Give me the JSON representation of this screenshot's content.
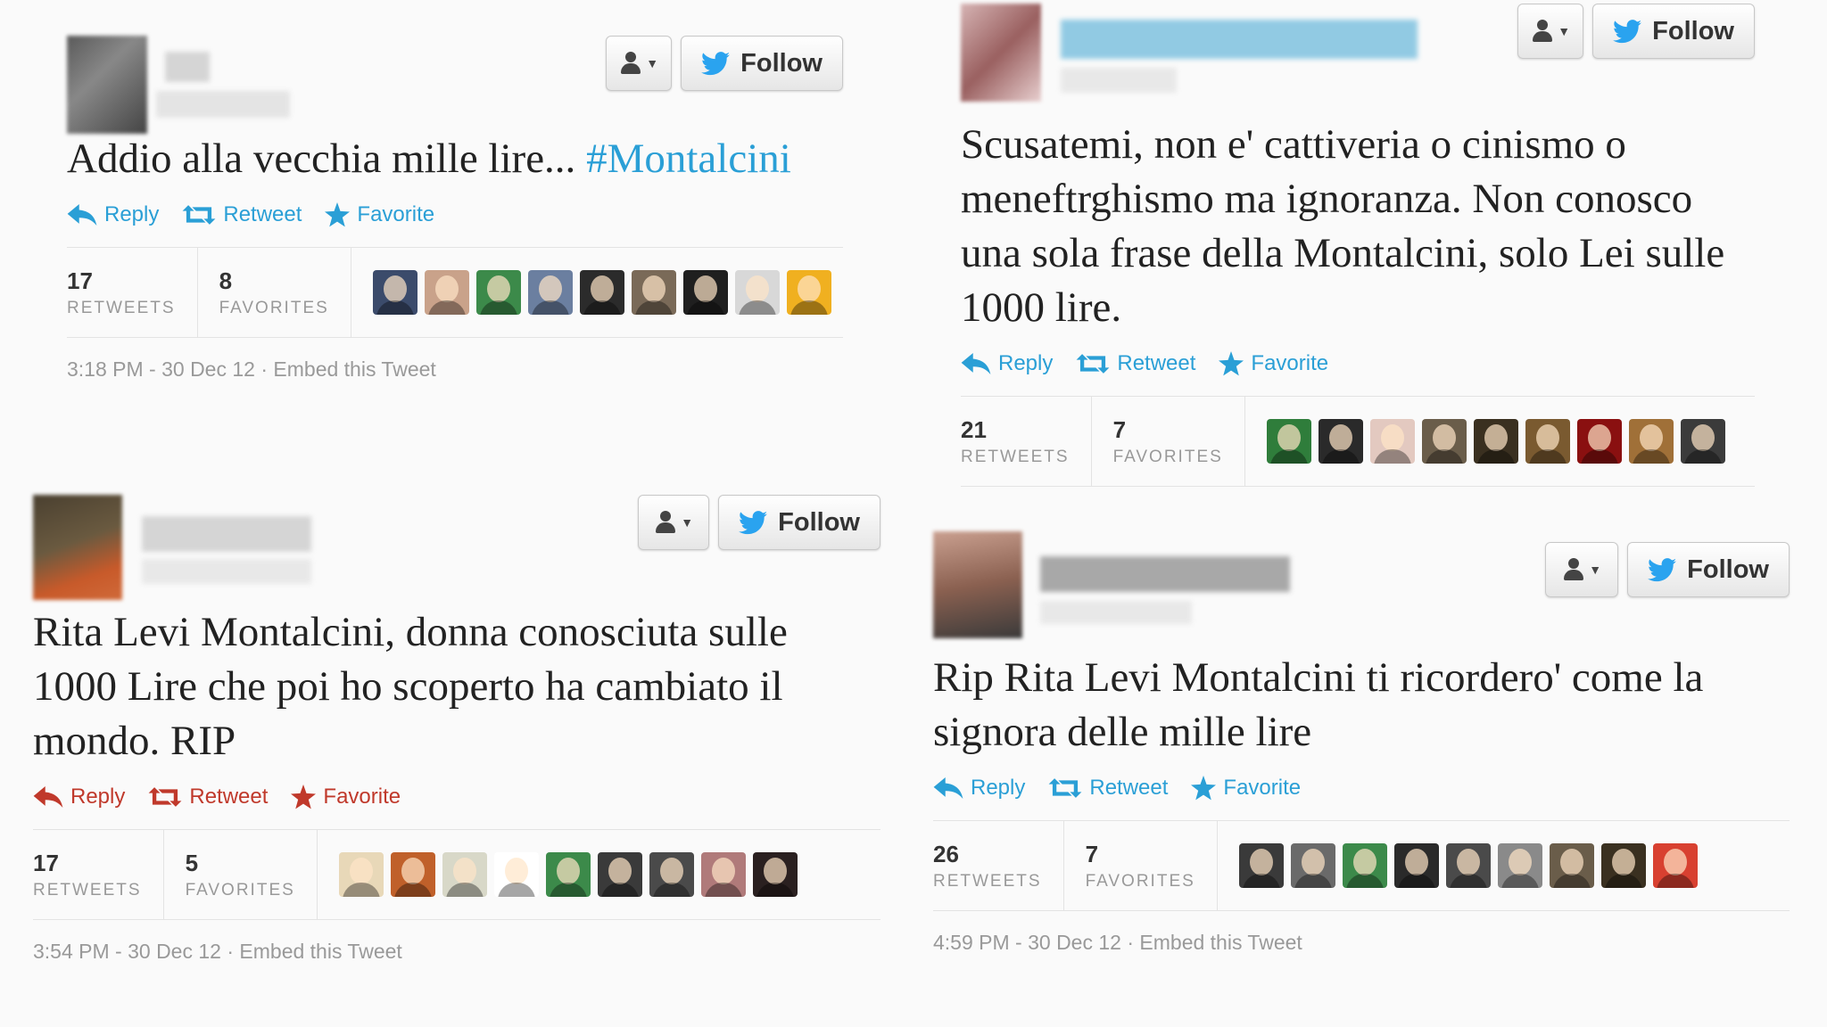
{
  "labels": {
    "follow": "Follow",
    "reply": "Reply",
    "retweet": "Retweet",
    "favorite": "Favorite",
    "retweets": "RETWEETS",
    "favorites": "FAVORITES",
    "embed": "Embed this Tweet"
  },
  "colors": {
    "link": "#2a9fd6",
    "action_red": "#c0392b",
    "twitter_bird": "#2aa3ef"
  },
  "tweets": [
    {
      "text": "Addio alla vecchia mille lire... ",
      "hashtag": "#Montalcini",
      "retweets": "17",
      "favorites": "8",
      "time": "3:18 PM - 30 Dec 12",
      "faces": [
        "#3b4b6b",
        "#c9a28a",
        "#3c8a4a",
        "#6b7fa0",
        "#2b2b2b",
        "#7a6a58",
        "#1f1f1f",
        "#d8d8d8",
        "#f0b020"
      ]
    },
    {
      "text": "Scusatemi, non e' cattiveria o cinismo o meneftrghismo ma ignoranza. Non conosco una sola frase della Montalcini, solo Lei sulle 1000 lire.",
      "retweets": "21",
      "favorites": "7",
      "time": "",
      "faces": [
        "#2f7d3b",
        "#2a2a2a",
        "#e3c9c0",
        "#6a5d4a",
        "#3a3020",
        "#7a5a30",
        "#8a1010",
        "#a07038",
        "#3b3b3b"
      ]
    },
    {
      "text": "Rita Levi Montalcini, donna conosciuta sulle 1000 Lire che poi ho scoperto ha cambiato il mondo. RIP",
      "retweets": "17",
      "favorites": "5",
      "time": "3:54 PM - 30 Dec 12",
      "faces": [
        "#e8d8b8",
        "#c0602a",
        "#d8d8c8",
        "#ffffff",
        "#3c8a4a",
        "#3a3a3a",
        "#4a4a4a",
        "#b07a7a",
        "#2a2020"
      ]
    },
    {
      "text": "Rip Rita Levi Montalcini ti ricordero' come la signora delle mille lire",
      "retweets": "26",
      "favorites": "7",
      "time": "4:59 PM - 30 Dec 12",
      "faces": [
        "#3a3a3a",
        "#6a6a6a",
        "#3c8a4a",
        "#2a2a2a",
        "#4a4a4a",
        "#8a8a8a",
        "#6a5d4a",
        "#3a3020",
        "#d84030"
      ]
    }
  ]
}
